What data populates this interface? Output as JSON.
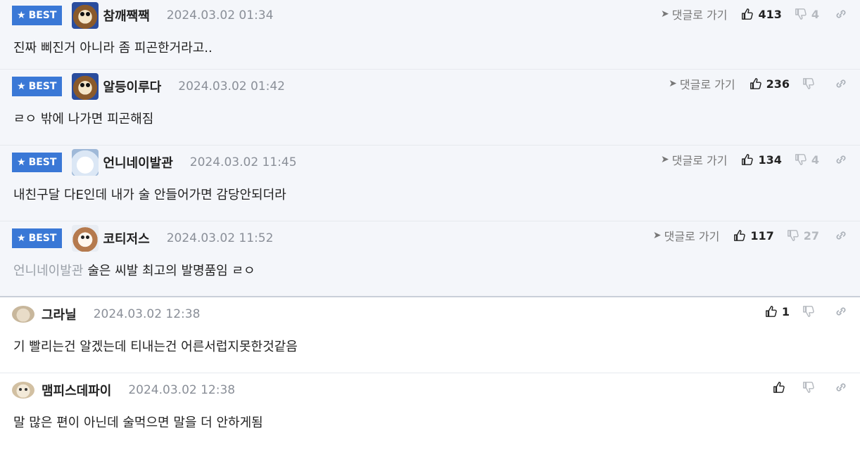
{
  "best_label": "BEST",
  "goto_label": "댓글로 가기",
  "comments": [
    {
      "nick": "참깨짹짹",
      "date": "2024.03.02 01:34",
      "text": "진짜 삐진거 아니라 좀 피곤한거라고..",
      "up": "413",
      "down": "4",
      "best": true
    },
    {
      "nick": "알등이루다",
      "date": "2024.03.02 01:42",
      "text": "ㄹㅇ 밖에 나가면 피곤해짐",
      "up": "236",
      "down": "",
      "best": true
    },
    {
      "nick": "언니네이발관",
      "date": "2024.03.02 11:45",
      "text": "내친구달 다E인데 내가 술 안들어가면 감당안되더라",
      "up": "134",
      "down": "4",
      "best": true
    },
    {
      "nick": "코티저스",
      "date": "2024.03.02 11:52",
      "mention": "언니네이발관",
      "text": "술은 씨발 최고의 발명품임 ㄹㅇ",
      "up": "117",
      "down": "27",
      "best": true
    },
    {
      "nick": "그라닐",
      "date": "2024.03.02 12:38",
      "text": "기 빨리는건 알겠는데 티내는건 어른서럽지못한것같음",
      "up": "1",
      "down": "",
      "best": false
    },
    {
      "nick": "맴피스데파이",
      "date": "2024.03.02 12:38",
      "text": "말 많은 편이 아닌데 술먹으면 말을 더 안하게됨",
      "up": "",
      "down": "",
      "best": false
    }
  ]
}
